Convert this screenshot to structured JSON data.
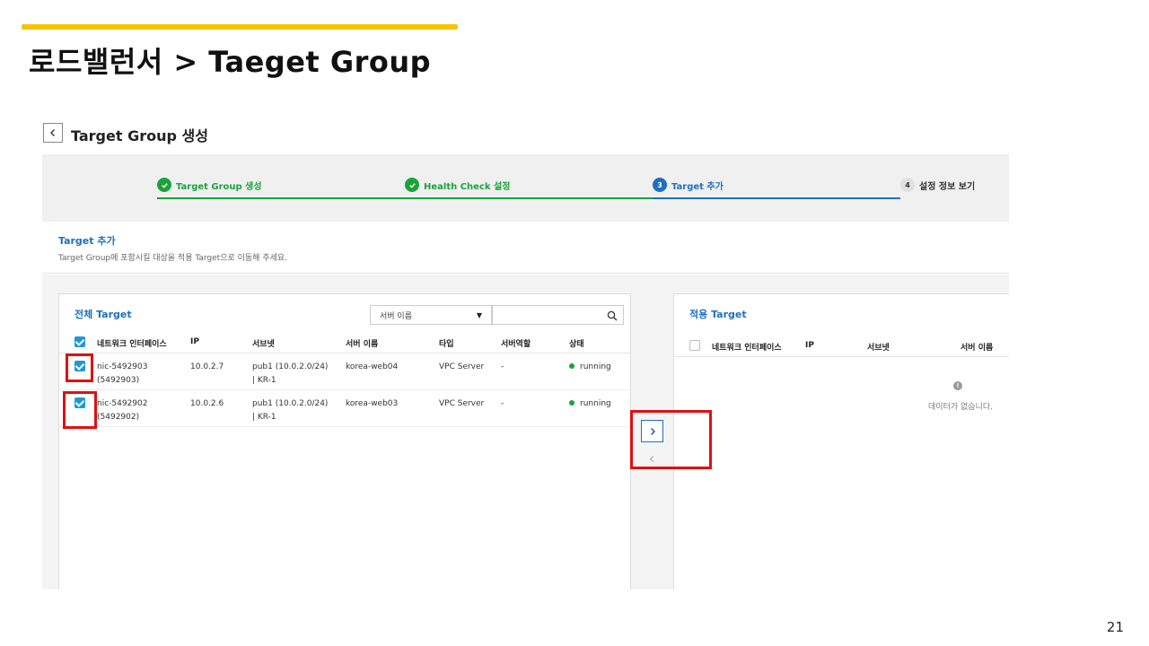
{
  "slide": {
    "title": "로드밸런서 > Taeget Group",
    "page_number": "21",
    "accent_color": "#f5c400",
    "highlight_color": "#e01010"
  },
  "header": {
    "title": "Target Group 생성"
  },
  "steps": [
    {
      "label": "Target Group 생성",
      "state": "done",
      "marker": "check-icon"
    },
    {
      "label": "Health Check 설정",
      "state": "done",
      "marker": "check-icon"
    },
    {
      "label": "Target 추가",
      "state": "active",
      "marker": "3"
    },
    {
      "label": "설정 정보 보기",
      "state": "todo",
      "marker": "4"
    }
  ],
  "section": {
    "title": "Target 추가",
    "description": "Target Group에 포함시킬 대상을 적용 Target으로 이동해 주세요."
  },
  "all_targets": {
    "title": "전체 Target",
    "filter_select": "서버 이름",
    "search_value": "",
    "header_checked": true,
    "columns": [
      "네트워크 인터페이스",
      "IP",
      "서브넷",
      "서버 이름",
      "타입",
      "서버역할",
      "상태"
    ],
    "rows": [
      {
        "checked": true,
        "nic": "nic-5492903",
        "nic_id": "(5492903)",
        "ip": "10.0.2.7",
        "subnet": "pub1 (10.0.2.0/24)",
        "subnet_zone": "| KR-1",
        "server_name": "korea-web04",
        "type": "VPC Server",
        "role": "-",
        "status": "running"
      },
      {
        "checked": true,
        "nic": "nic-5492902",
        "nic_id": "(5492902)",
        "ip": "10.0.2.6",
        "subnet": "pub1 (10.0.2.0/24)",
        "subnet_zone": "| KR-1",
        "server_name": "korea-web03",
        "type": "VPC Server",
        "role": "-",
        "status": "running"
      }
    ]
  },
  "applied_targets": {
    "title": "적용 Target",
    "header_checked": false,
    "columns": [
      "네트워크 인터페이스",
      "IP",
      "서브넷",
      "서버 이름"
    ],
    "empty_text": "데이터가 없습니다."
  },
  "colors": {
    "done": "#1aa33b",
    "active": "#1f6fbf",
    "checkbox": "#1d9ad6"
  }
}
